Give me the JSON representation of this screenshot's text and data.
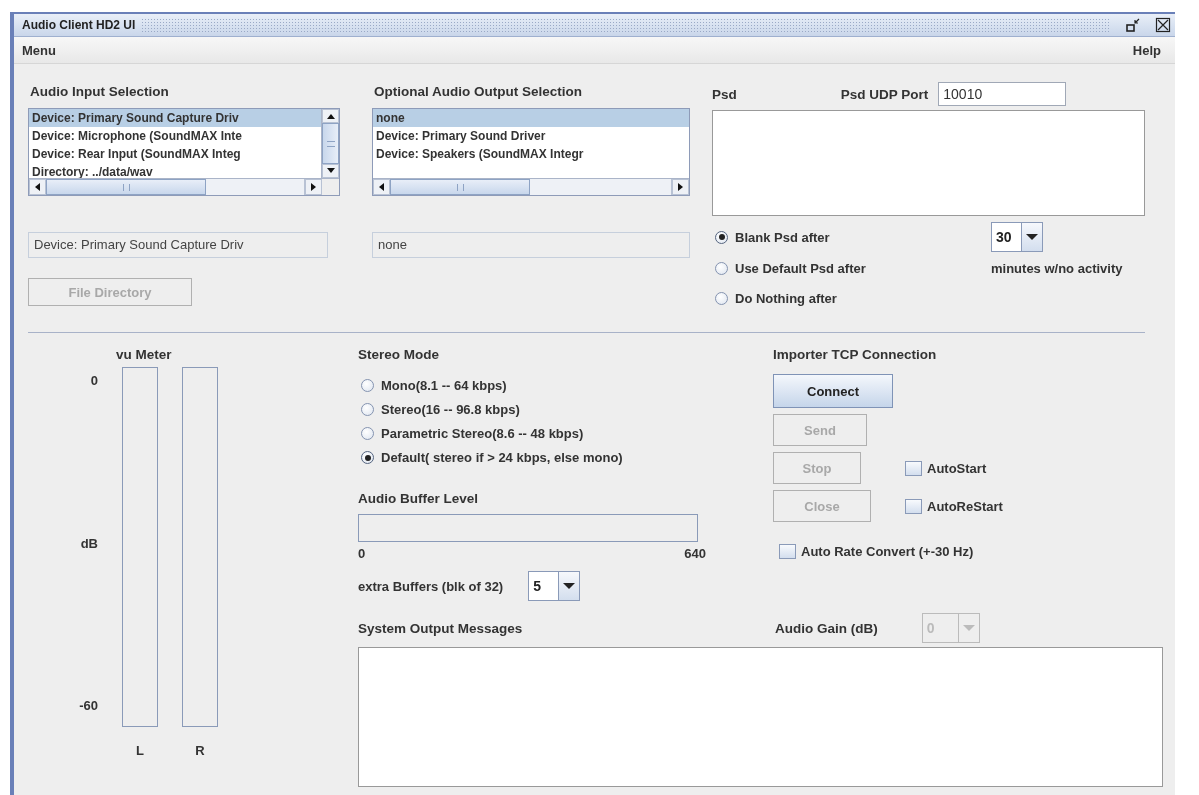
{
  "window": {
    "title": "Audio Client HD2 UI"
  },
  "menu_bar": [
    {
      "label": "Menu"
    },
    {
      "label": "Help"
    }
  ],
  "audio_input": {
    "heading": "Audio Input Selection",
    "items": [
      {
        "label": "Device: Primary Sound Capture Driv",
        "selected": true
      },
      {
        "label": "Device: Microphone (SoundMAX Inte",
        "selected": false
      },
      {
        "label": "Device: Rear Input (SoundMAX Integ",
        "selected": false
      },
      {
        "label": "Directory: ../data/wav",
        "selected": false
      }
    ],
    "selected_value": "Device: Primary Sound Capture Driv",
    "button": {
      "label": "File Directory",
      "disabled": true
    }
  },
  "audio_output": {
    "heading": "Optional Audio Output Selection",
    "items": [
      {
        "label": "none",
        "selected": true
      },
      {
        "label": "Device: Primary Sound Driver",
        "selected": false
      },
      {
        "label": "Device: Speakers (SoundMAX Integr",
        "selected": false
      }
    ],
    "selected_value": "none"
  },
  "psd": {
    "heading": "Psd",
    "port_label": "Psd UDP Port",
    "port": "10010",
    "options": [
      {
        "label": "Blank Psd after",
        "selected": true
      },
      {
        "label": "Use Default Psd after",
        "selected": false
      },
      {
        "label": "Do Nothing after",
        "selected": false
      }
    ],
    "timeout": "30",
    "timeout_note": "minutes w/no activity"
  },
  "vu_meter": {
    "title": "vu Meter",
    "scale": [
      "0",
      "dB",
      "-60"
    ],
    "channels": [
      {
        "name": "L",
        "level": 0
      },
      {
        "name": "R",
        "level": 0
      }
    ]
  },
  "stereo_mode": {
    "heading": "Stereo Mode",
    "options": [
      {
        "label": "Mono(8.1 -- 64 kbps)",
        "selected": false
      },
      {
        "label": "Stereo(16 -- 96.8 kbps)",
        "selected": false
      },
      {
        "label": "Parametric Stereo(8.6 -- 48 kbps)",
        "selected": false
      },
      {
        "label": "Default( stereo if > 24 kbps, else mono)",
        "selected": true
      }
    ]
  },
  "buffer": {
    "heading": "Audio Buffer Level",
    "level": 0,
    "min": "0",
    "max": "640",
    "extra_label": "extra Buffers (blk of 32)",
    "extra_value": "5"
  },
  "importer": {
    "heading": "Importer TCP Connection",
    "buttons": [
      {
        "label": "Connect",
        "disabled": false
      },
      {
        "label": "Send",
        "disabled": true
      },
      {
        "label": "Stop",
        "disabled": true
      },
      {
        "label": "Close",
        "disabled": true
      }
    ],
    "checkboxes": [
      {
        "label": "AutoStart",
        "checked": false
      },
      {
        "label": "AutoReStart",
        "checked": false
      }
    ],
    "rate_convert": {
      "label": "Auto Rate Convert (+-30 Hz)",
      "checked": false
    }
  },
  "messages": {
    "heading": "System Output Messages"
  },
  "gain": {
    "label": "Audio Gain  (dB)",
    "value": "0",
    "disabled": true
  }
}
